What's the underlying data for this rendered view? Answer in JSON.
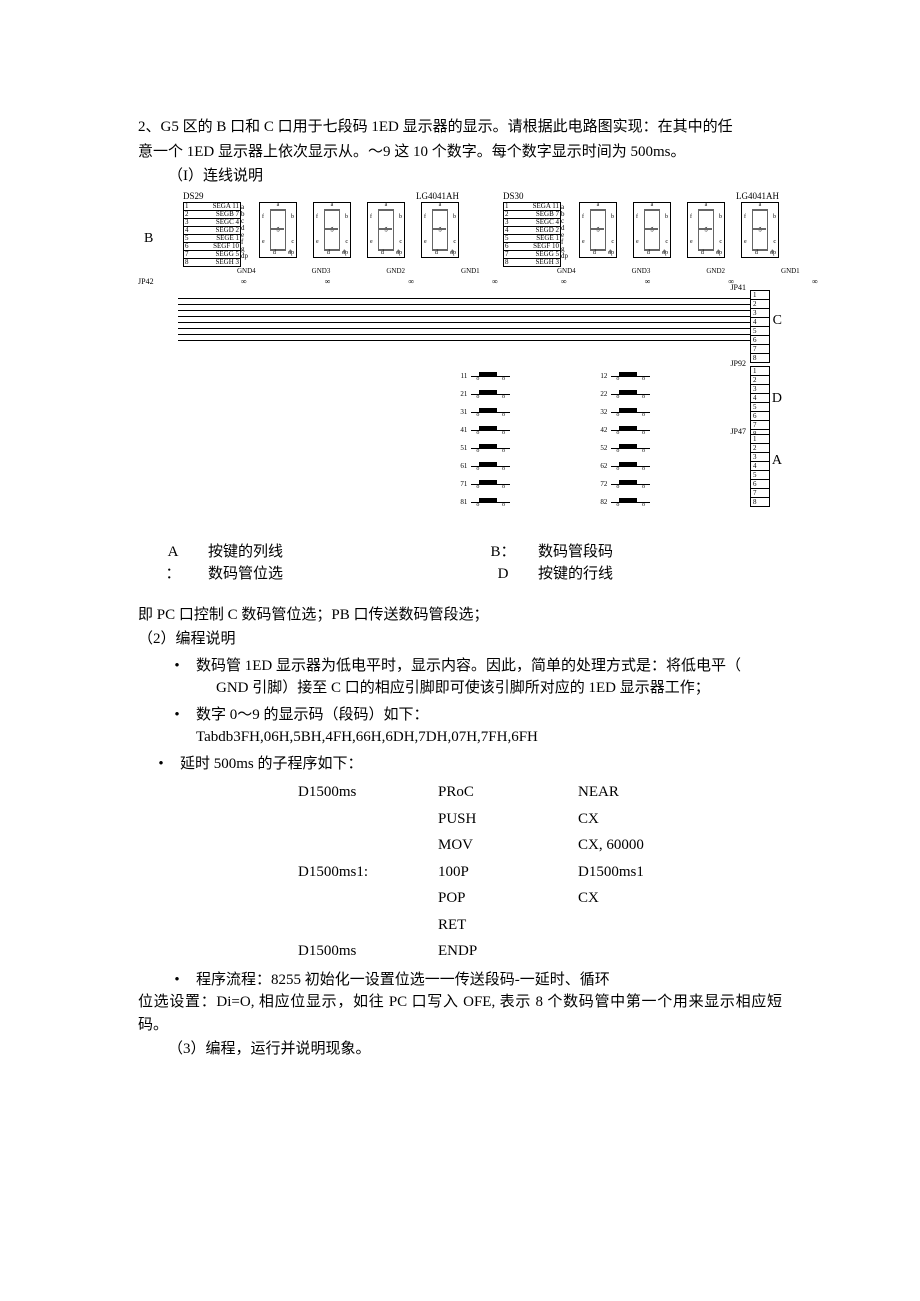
{
  "intro": {
    "line1": "2、G5 区的 B 口和 C 口用于七段码 1ED 显示器的显示。请根据此电路图实现：在其中的任",
    "line2": "意一个 1ED 显示器上依次显示从。～9 这 10 个数字。每个数字显示时间为 500ms。",
    "item1": "（I）连线说明"
  },
  "diagram": {
    "ds29": "DS29",
    "ds30": "DS30",
    "lg_l": "LG4041AH",
    "lg_r": "LG4041AH",
    "jp42": "JP42",
    "jp41": "JP41",
    "jp92": "JP92",
    "jp47": "JP47",
    "pins": [
      "SEGA 11",
      "SEGB 7",
      "SEGC 4",
      "SEGD 2",
      "SEGE 1",
      "SEGF 10",
      "SEGG 5",
      "SEGH 3"
    ],
    "segletters": [
      "a",
      "b",
      "c",
      "d",
      "e",
      "f",
      "g",
      "dp"
    ],
    "numbers18": [
      "1",
      "2",
      "3",
      "4",
      "5",
      "6",
      "7",
      "8"
    ],
    "gnd": [
      "GND4",
      "GND3",
      "GND2",
      "GND1"
    ],
    "inf": "∞",
    "ssd": {
      "a": "a",
      "b": "b",
      "c": "c",
      "d": "d",
      "e": "e",
      "f": "f",
      "g": "g",
      "dp": "dp"
    },
    "B": "B",
    "C": "C",
    "D": "D",
    "A": "A",
    "keys_left": [
      "11",
      "21",
      "31",
      "41",
      "51",
      "61",
      "71",
      "81"
    ],
    "keys_right": [
      "12",
      "22",
      "32",
      "42",
      "52",
      "62",
      "72",
      "82"
    ]
  },
  "legend": {
    "A_key": "A",
    "A_colon": "：",
    "A_val": "按键的列线",
    "B_key": "B：",
    "B_val": "数码管段码",
    "C_val": "数码管位选",
    "D_key": "D",
    "D_val": "按键的行线"
  },
  "section": {
    "pc_pb": "即 PC 口控制 C 数码管位选；PB 口传送数码管段选；",
    "p2": "（2）编程说明",
    "b1a": "数码管 1ED 显示器为低电平时，显示内容。因此，简单的处理方式是：将低电平（",
    "b1b": "GND 引脚）接至 C 口的相应引脚即可使该引脚所对应的 1ED 显示器工作；",
    "b2": "数字 0～9 的显示码（段码）如下：",
    "codes": "Tabdb3FH,06H,5BH,4FH,66H,6DH,7DH,07H,7FH,6FH",
    "b3": "延时 500ms 的子程序如下：",
    "b4": "程序流程：8255 初始化一设置位选一一传送段码-一延时、循环",
    "p_bit": "位选设置：Di=O, 相应位显示，如往 PC 口写入 OFE, 表示 8 个数码管中第一个用来显示相应短码。",
    "p3": "（3）编程，运行并说明现象。"
  },
  "code": {
    "r1": {
      "c1": "D1500ms",
      "c2": "PRoC",
      "c3": "NEAR"
    },
    "r2": {
      "c1": "",
      "c2": "PUSH",
      "c3": "CX"
    },
    "r3": {
      "c1": "",
      "c2": "MOV",
      "c3": "CX, 60000"
    },
    "r4": {
      "c1": "D1500ms1:",
      "c2": "100P",
      "c3": "D1500ms1"
    },
    "r5": {
      "c1": "",
      "c2": "POP",
      "c3": "CX"
    },
    "r6": {
      "c1": "",
      "c2": "RET",
      "c3": ""
    },
    "r7": {
      "c1": "D1500ms",
      "c2": "ENDP",
      "c3": ""
    }
  }
}
